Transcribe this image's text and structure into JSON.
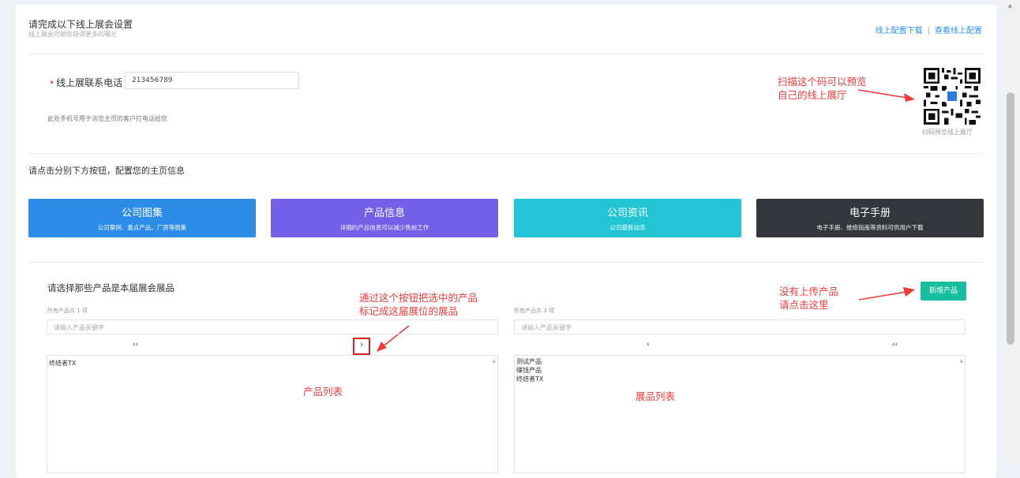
{
  "header": {
    "title": "请完成以下线上展会设置",
    "subtitle": "线上展会可助您获得更多的曝光",
    "link_download": "线上配置下载",
    "separator": "|",
    "link_view": "查看线上配置"
  },
  "phone": {
    "required_mark": "•",
    "label": "线上展联系电话",
    "value": "213456789",
    "hint": "此处手机号用于浏览主页的客户打电话给您"
  },
  "qr": {
    "caption": "扫码预览线上展厅"
  },
  "annotations": {
    "qr_line1": "扫描这个码可以预览",
    "qr_line2": "自己的线上展厅",
    "move_line1": "通过这个按钮把选中的产品",
    "move_line2": "标记成这届展位的展品",
    "new_line1": "没有上传产品",
    "new_line2": "请点击这里",
    "left_list": "产品列表",
    "right_list": "展品列表"
  },
  "section_config": {
    "title": "请点击分别下方按钮，配置您的主页信息",
    "buttons": [
      {
        "title": "公司图集",
        "subtitle": "公司案例、重点产品、厂房等图集",
        "color": "#2d8ce8"
      },
      {
        "title": "产品信息",
        "subtitle": "详细的产品信息可以减少售前工作",
        "color": "#7460e8"
      },
      {
        "title": "公司资讯",
        "subtitle": "公司最新动态",
        "color": "#23c5d4"
      },
      {
        "title": "电子手册",
        "subtitle": "电子手册、维修指南等资料可供用户下载",
        "color": "#33373c"
      }
    ]
  },
  "section_products": {
    "title": "请选择那些产品是本届展会展品",
    "new_button": "新增产品",
    "left": {
      "count": "所有产品共 1 项",
      "search_placeholder": "请输入产品关键字",
      "move_all": "››",
      "move_selected": "›",
      "items": [
        "终结者TX"
      ]
    },
    "right": {
      "count": "所有产品共 3 项",
      "search_placeholder": "请输入产品关键字",
      "remove_selected": "‹",
      "remove_all": "‹‹",
      "items": [
        "测试产品",
        "赚钱产品",
        "终结者TX"
      ]
    }
  }
}
